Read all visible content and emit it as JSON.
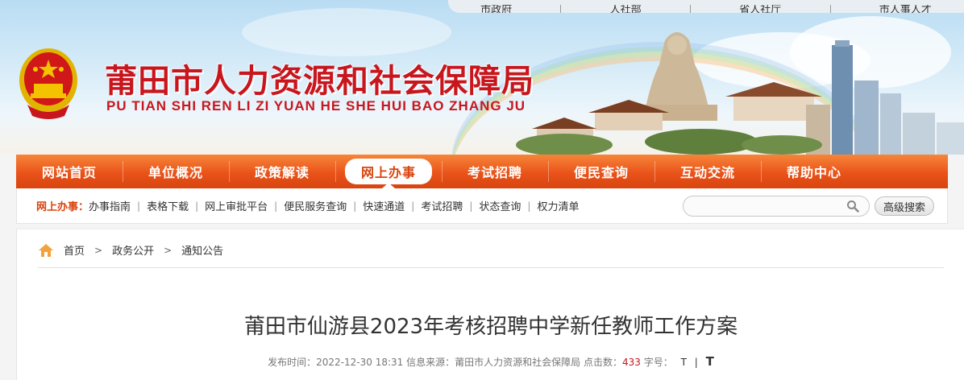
{
  "top_links": [
    "市政府",
    "人社部",
    "省人社厅",
    "市人事人才"
  ],
  "site": {
    "title_cn": "莆田市人力资源和社会保障局",
    "title_en": "PU TIAN SHI REN LI ZI YUAN HE SHE HUI BAO ZHANG JU"
  },
  "nav": {
    "items": [
      "网站首页",
      "单位概况",
      "政策解读",
      "网上办事",
      "考试招聘",
      "便民查询",
      "互动交流",
      "帮助中心"
    ],
    "active": "网上办事"
  },
  "subnav": {
    "label": "网上办事：",
    "links": [
      "办事指南",
      "表格下载",
      "网上审批平台",
      "便民服务查询",
      "快速通道",
      "考试招聘",
      "状态查询",
      "权力清单"
    ],
    "search_placeholder": "",
    "advanced_search": "高级搜索"
  },
  "breadcrumb": [
    "首页",
    "政务公开",
    "通知公告"
  ],
  "article": {
    "title": "莆田市仙游县2023年考核招聘中学新任教师工作方案",
    "publish_label": "发布时间：",
    "publish_time": "2022-12-30 18:31",
    "source_label": "信息来源：",
    "source": "莆田市人力资源和社会保障局",
    "views_label": "点击数：",
    "views": "433",
    "font_label": "字号：",
    "font_small": "T",
    "font_sep": "|",
    "font_big": "T"
  },
  "colors": {
    "brand_red": "#c8161e",
    "nav_orange": "#e9531a"
  }
}
